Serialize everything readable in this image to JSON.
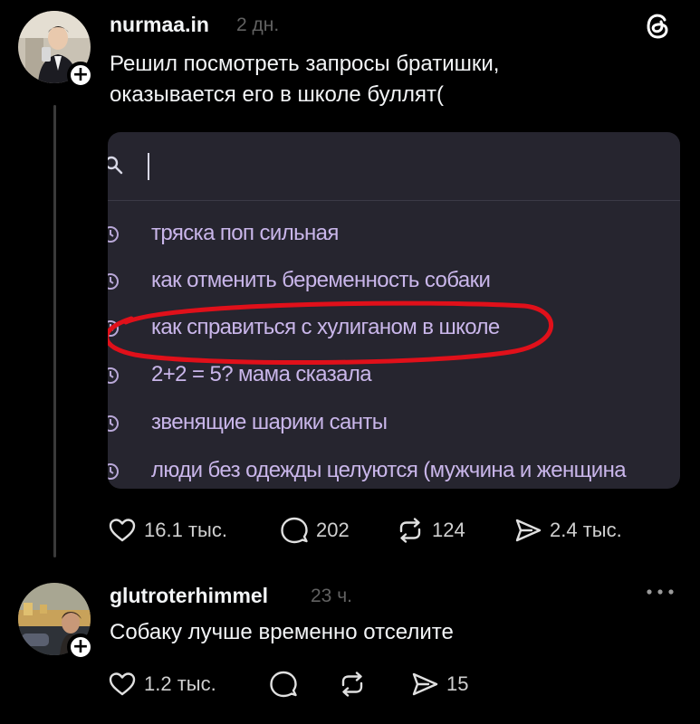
{
  "post": {
    "username": "nurmaa.in",
    "time": "2 дн.",
    "text_line1": "Решил посмотреть запросы братишки,",
    "text_line2": "оказывается его в школе буллят(",
    "search_suggestions": [
      "тряска поп сильная",
      "как отменить беременность собаки",
      "как справиться с хулиганом в школе",
      "2+2 = 5? мама сказала",
      "звенящие шарики санты",
      "люди без одежды целуются (мужчина и женщина"
    ],
    "highlighted_suggestion_index": 2,
    "likes": "16.1 тыс.",
    "comments": "202",
    "reposts": "124",
    "shares": "2.4 тыс."
  },
  "reply": {
    "username": "glutroterhimmel",
    "time": "23 ч.",
    "text": "Собаку лучше временно отселите",
    "likes": "1.2 тыс.",
    "shares": "15"
  },
  "icons": {
    "logo": "threads-logo-icon",
    "like": "heart-icon",
    "comment": "comment-bubble-icon",
    "repost": "repost-icon",
    "share": "send-icon",
    "more": "more-dots-icon",
    "follow": "plus-icon",
    "history": "clock-icon",
    "search": "search-icon"
  },
  "colors": {
    "background": "#000000",
    "text": "#f3f5f7",
    "muted": "#616161",
    "suggestion_text": "#c9b6ea",
    "screenshot_bg": "#26252f",
    "highlight_circle": "#e0101a"
  }
}
